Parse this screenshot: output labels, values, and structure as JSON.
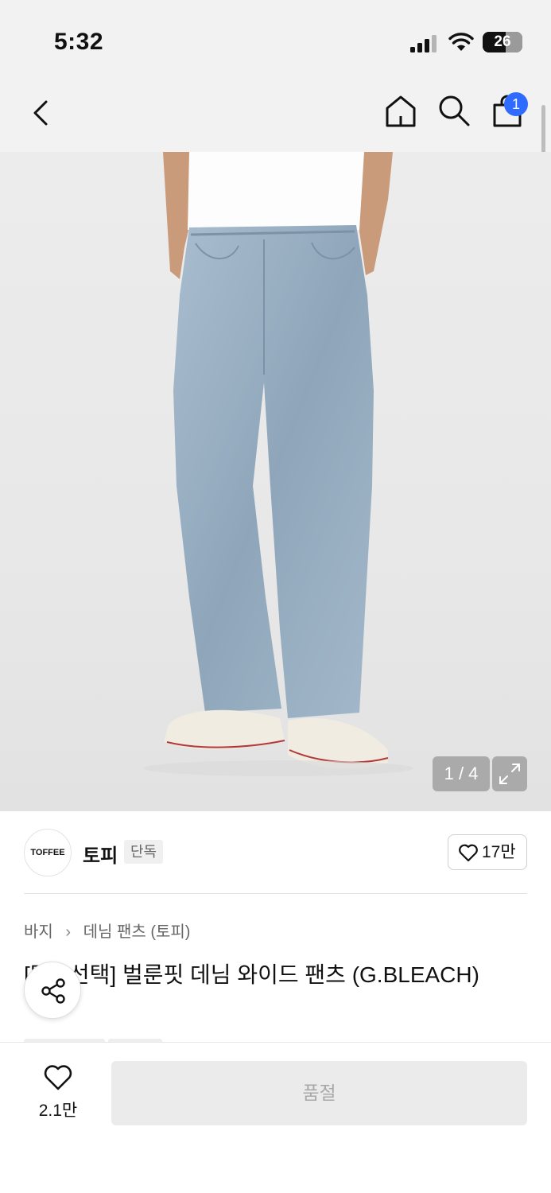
{
  "status_bar": {
    "time": "5:32",
    "battery": "26",
    "icons": [
      "cellular-signal-icon",
      "wifi-icon",
      "battery-icon"
    ]
  },
  "nav": {
    "icons": [
      "chevron-left-icon",
      "home-icon",
      "search-icon",
      "shopping-bag-icon"
    ],
    "cart_badge": "1"
  },
  "product_image": {
    "counter": "1 / 4"
  },
  "brand": {
    "logo_text": "TOFFEE",
    "name": "토피",
    "tag": "단독",
    "like_count": "17만"
  },
  "breadcrumb": {
    "items": [
      "바지",
      "데님 팬츠 (토피)"
    ]
  },
  "product": {
    "title": "[택1 선택] 벌룬핏 데님 와이드 팬츠 (G.BLEACH)"
  },
  "bottom_bar": {
    "like_count": "2.1만",
    "soldout_label": "품절"
  },
  "colors": {
    "accent_badge": "#2f6bff",
    "background_header": "#f2f2f2",
    "soldout_bg": "#ebebeb"
  }
}
